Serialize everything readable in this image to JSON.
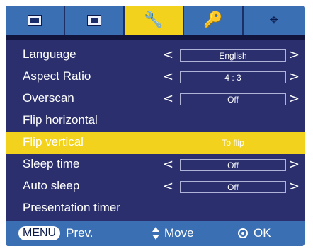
{
  "tabs": [
    {
      "name": "picture-tab",
      "icon": "monitor-icon"
    },
    {
      "name": "screen-tab",
      "icon": "monitor-small-icon"
    },
    {
      "name": "settings-tab",
      "icon": "wrench-icon",
      "active": true
    },
    {
      "name": "options-tab",
      "icon": "key-icon"
    },
    {
      "name": "inputs-tab",
      "icon": "input-icon"
    }
  ],
  "menu": {
    "items": [
      {
        "label": "Language",
        "value": "English",
        "type": "select"
      },
      {
        "label": "Aspect Ratio",
        "value": "4 : 3",
        "type": "select"
      },
      {
        "label": "Overscan",
        "value": "Off",
        "type": "select"
      },
      {
        "label": "Flip horizontal",
        "value": "",
        "type": "action"
      },
      {
        "label": "Flip vertical",
        "value": "To flip",
        "type": "action",
        "highlight": true
      },
      {
        "label": "Sleep time",
        "value": "Off",
        "type": "select"
      },
      {
        "label": "Auto sleep",
        "value": "Off",
        "type": "select"
      },
      {
        "label": "Presentation timer",
        "value": "",
        "type": "action"
      }
    ]
  },
  "footer": {
    "menu_key": "MENU",
    "menu_label": "Prev.",
    "move_label": "Move",
    "ok_label": "OK"
  },
  "arrows": {
    "left": "<",
    "right": ">"
  },
  "colors": {
    "panel": "#2b2f6e",
    "tabbar": "#3a6fb4",
    "highlight": "#f2d21c",
    "text": "#ffffff"
  }
}
